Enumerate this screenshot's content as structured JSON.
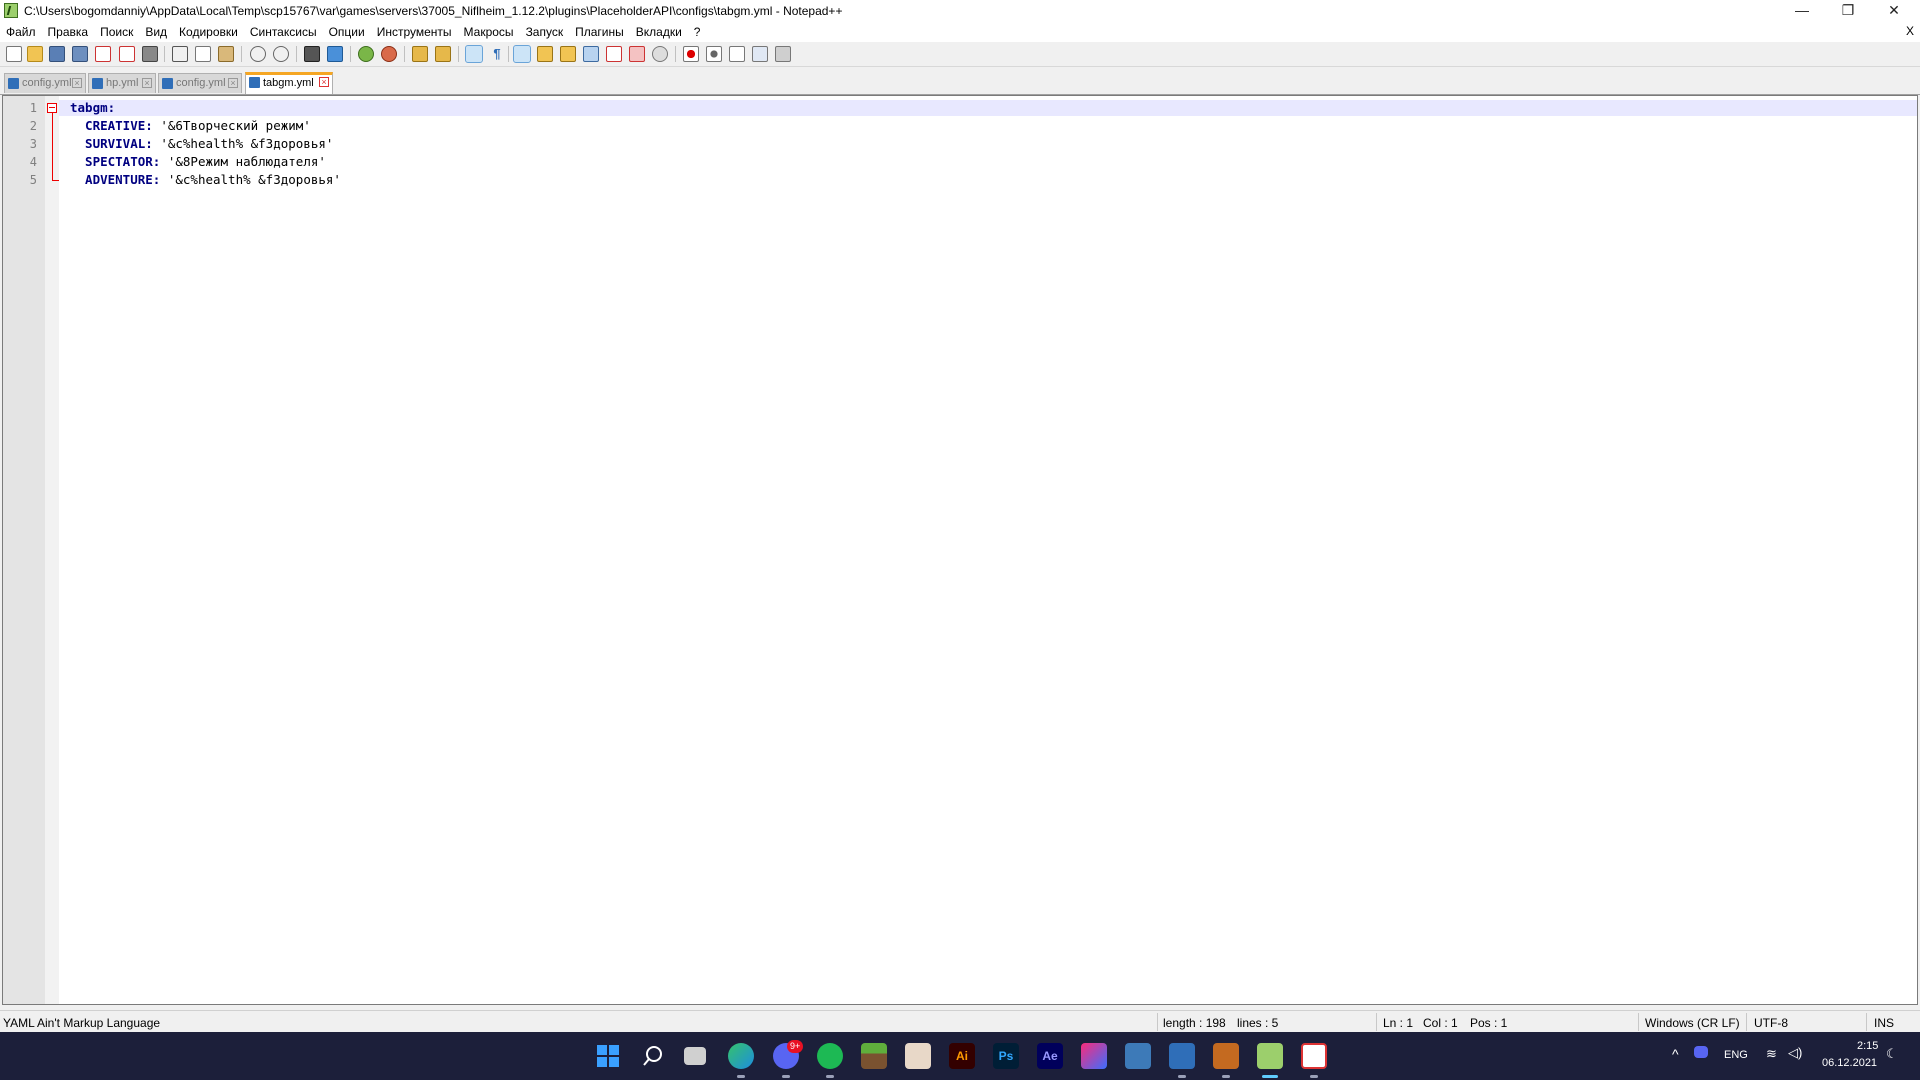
{
  "window": {
    "title": "C:\\Users\\bogomdanniy\\AppData\\Local\\Temp\\scp15767\\var\\games\\servers\\37005_Niflheim_1.12.2\\plugins\\PlaceholderAPI\\configs\\tabgm.yml - Notepad++",
    "minimize": "—",
    "maximize": "❐",
    "close": "✕"
  },
  "menu": {
    "items": [
      "Файл",
      "Правка",
      "Поиск",
      "Вид",
      "Кодировки",
      "Синтаксисы",
      "Опции",
      "Инструменты",
      "Макросы",
      "Запуск",
      "Плагины",
      "Вкладки",
      "?"
    ],
    "close": "X"
  },
  "tabs": [
    {
      "label": "config.yml",
      "active": false
    },
    {
      "label": "hp.yml",
      "active": false
    },
    {
      "label": "config.yml",
      "active": false
    },
    {
      "label": "tabgm.yml",
      "active": true
    }
  ],
  "editor": {
    "lines": [
      {
        "num": "1",
        "key": "tabgm",
        "value": ""
      },
      {
        "num": "2",
        "key": "  CREATIVE",
        "value": " '&6Творческий режим'"
      },
      {
        "num": "3",
        "key": "  SURVIVAL",
        "value": " '&c%health% &fЗдоровья'"
      },
      {
        "num": "4",
        "key": "  SPECTATOR",
        "value": " '&8Режим наблюдателя'"
      },
      {
        "num": "5",
        "key": "  ADVENTURE",
        "value": " '&c%health% &fЗдоровья'"
      }
    ]
  },
  "status": {
    "language": "YAML Ain't Markup Language",
    "length": "length : 198",
    "lines": "lines : 5",
    "ln": "Ln : 1",
    "col": "Col : 1",
    "pos": "Pos : 1",
    "eol": "Windows (CR LF)",
    "encoding": "UTF-8",
    "mode": "INS"
  },
  "taskbar": {
    "discord_badge": "9+",
    "tray_language": "ENG",
    "time": "2:15",
    "date": "06.12.2021"
  },
  "colors": {
    "accent_tab": "#f5a623",
    "keyword": "#000080",
    "fold": "#e00000",
    "taskbar_bg": "#1c1f3a"
  }
}
